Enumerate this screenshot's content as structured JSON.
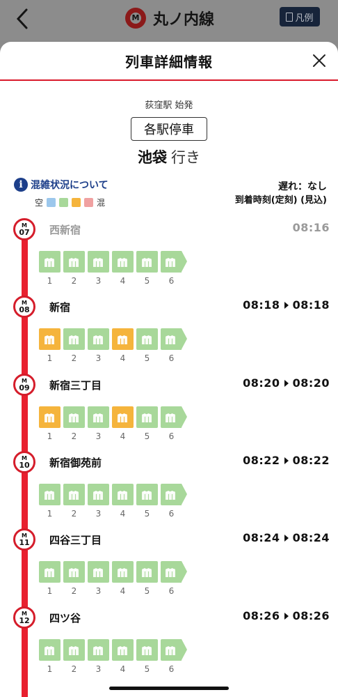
{
  "app": {
    "title": "丸ノ内線",
    "logo_letter": "M",
    "legend_label": "凡例"
  },
  "sheet": {
    "title": "列車詳細情報"
  },
  "train": {
    "origin": "荻窪駅 始発",
    "type": "各駅停車",
    "destination": "池袋",
    "destination_suffix": "行き",
    "congestion_link": "混雑状況について",
    "scale_low": "空",
    "scale_high": "混",
    "delay": "遅れ：なし",
    "time_header": "到着時刻(定刻)  (見込)"
  },
  "colors": {
    "scale": [
      "#9cc7ec",
      "#a8d89a",
      "#f5b43c",
      "#f0a1a1"
    ],
    "empty": "#a8d89a",
    "moderate": "#f5b43c",
    "route": "#e8202f"
  },
  "stations": [
    {
      "line": "M",
      "number": "07",
      "name": "西新宿",
      "time": "08:16",
      "passed": true,
      "cars": [
        "1",
        "2",
        "3",
        "4",
        "5",
        "6"
      ],
      "levels": [
        "empty",
        "empty",
        "empty",
        "empty",
        "empty",
        "empty"
      ]
    },
    {
      "line": "M",
      "number": "08",
      "name": "新宿",
      "time_scheduled": "08:18",
      "time_expected": "08:18",
      "cars": [
        "1",
        "2",
        "3",
        "4",
        "5",
        "6"
      ],
      "levels": [
        "moderate",
        "empty",
        "empty",
        "moderate",
        "empty",
        "empty"
      ]
    },
    {
      "line": "M",
      "number": "09",
      "name": "新宿三丁目",
      "time_scheduled": "08:20",
      "time_expected": "08:20",
      "cars": [
        "1",
        "2",
        "3",
        "4",
        "5",
        "6"
      ],
      "levels": [
        "moderate",
        "empty",
        "empty",
        "moderate",
        "empty",
        "empty"
      ]
    },
    {
      "line": "M",
      "number": "10",
      "name": "新宿御苑前",
      "time_scheduled": "08:22",
      "time_expected": "08:22",
      "cars": [
        "1",
        "2",
        "3",
        "4",
        "5",
        "6"
      ],
      "levels": [
        "empty",
        "empty",
        "empty",
        "empty",
        "empty",
        "empty"
      ]
    },
    {
      "line": "M",
      "number": "11",
      "name": "四谷三丁目",
      "time_scheduled": "08:24",
      "time_expected": "08:24",
      "cars": [
        "1",
        "2",
        "3",
        "4",
        "5",
        "6"
      ],
      "levels": [
        "empty",
        "empty",
        "empty",
        "empty",
        "empty",
        "empty"
      ]
    },
    {
      "line": "M",
      "number": "12",
      "name": "四ツ谷",
      "time_scheduled": "08:26",
      "time_expected": "08:26",
      "cars": [
        "1",
        "2",
        "3",
        "4",
        "5",
        "6"
      ],
      "levels": [
        "empty",
        "empty",
        "empty",
        "empty",
        "empty",
        "empty"
      ]
    }
  ]
}
